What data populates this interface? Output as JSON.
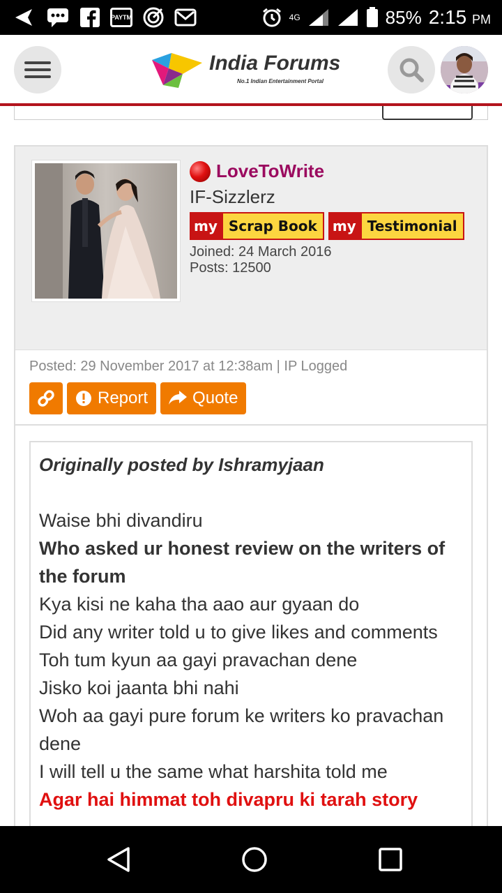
{
  "status_bar": {
    "network": "4G",
    "battery": "85%",
    "time": "2:15",
    "ampm": "PM",
    "paytm_label": "PAYTM",
    "icons": [
      "back-arrow-icon",
      "chat-icon",
      "facebook-icon",
      "paytm-icon",
      "target-icon",
      "mail-icon",
      "alarm-icon",
      "signal-icon",
      "battery-icon"
    ]
  },
  "header": {
    "logo_title": "India Forums",
    "logo_tagline": "No.1 Indian Entertainment Portal"
  },
  "post": {
    "username": "LoveToWrite",
    "user_group": "IF-Sizzlerz",
    "badges": [
      {
        "my": "my",
        "label": "Scrap Book"
      },
      {
        "my": "my",
        "label": "Testimonial"
      }
    ],
    "joined": "Joined: 24 March 2016",
    "posts": "Posts: 12500",
    "posted": "Posted: 29 November 2017 at 12:38am | IP Logged",
    "actions": {
      "report": "Report",
      "quote": "Quote"
    },
    "quote_header": "Originally posted by Ishramyjaan",
    "quote_lines": [
      {
        "text": "Waise bhi divandiru",
        "style": "normal"
      },
      {
        "text": "Who asked ur honest review on the writers of the forum",
        "style": "bold"
      },
      {
        "text": "Kya kisi ne kaha tha aao aur gyaan do",
        "style": "normal"
      },
      {
        "text": "Did any writer told u to give likes and comments",
        "style": "normal"
      },
      {
        "text": "Toh tum kyun aa gayi pravachan dene",
        "style": "normal"
      },
      {
        "text": "Jisko koi jaanta bhi nahi",
        "style": "normal"
      },
      {
        "text": "Woh aa gayi pure forum ke writers ko pravachan dene",
        "style": "normal"
      },
      {
        "text": "I will tell u the same what harshita told me",
        "style": "normal"
      },
      {
        "text": "Agar hai himmat toh divapru ki tarah story",
        "style": "red"
      }
    ]
  },
  "colors": {
    "accent_red": "#b3141d",
    "username": "#9b0a5f",
    "action_orange": "#f07a00",
    "badge_yellow": "#fcd640"
  }
}
